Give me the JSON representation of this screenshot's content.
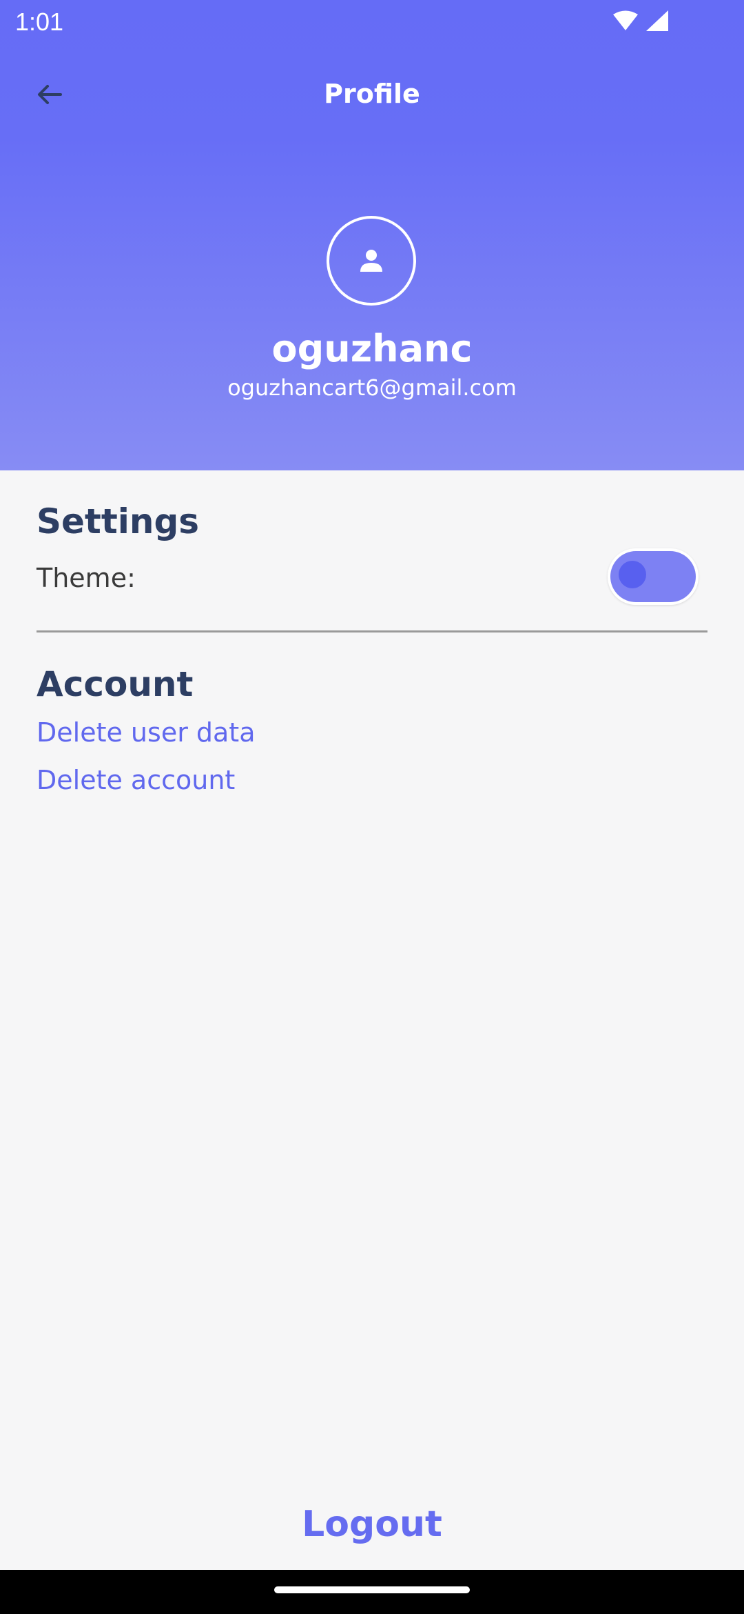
{
  "status_bar": {
    "time": "1:01",
    "icons": [
      "wifi-icon",
      "cellular-signal-icon"
    ]
  },
  "header": {
    "title": "Profile",
    "back_icon": "arrow-left-icon",
    "avatar_icon": "person-icon",
    "username": "oguzhanc",
    "email": "oguzhancart6@gmail.com"
  },
  "settings": {
    "title": "Settings",
    "theme_label": "Theme:",
    "theme_toggle_on": false
  },
  "account": {
    "title": "Account",
    "delete_user_data_label": "Delete user data",
    "delete_account_label": "Delete account"
  },
  "logout_label": "Logout",
  "colors": {
    "primary": "#666df6",
    "header_gradient_end": "#878cf4",
    "section_title": "#2d3e63",
    "link": "#6068ee",
    "background": "#f6f6f7"
  }
}
